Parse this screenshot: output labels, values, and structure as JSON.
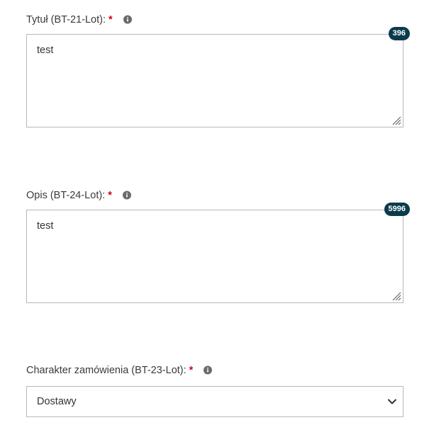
{
  "form": {
    "title_field": {
      "label": "Tytuł (BT-21-Lot):",
      "required_mark": "*",
      "value": "test",
      "counter": "396"
    },
    "description_field": {
      "label": "Opis (BT-24-Lot):",
      "required_mark": "*",
      "value": "test",
      "counter": "5996"
    },
    "contract_nature_field": {
      "label": "Charakter zamówienia (BT-23-Lot):",
      "required_mark": "*",
      "selected": "Dostawy"
    }
  },
  "icons": {
    "info": "info-icon",
    "resize": "resize-grip-icon",
    "dropdown": "chevron-down-icon"
  },
  "colors": {
    "required": "#d0021b",
    "counter_bg": "#0b3b4b",
    "border": "#b8b8b8"
  }
}
